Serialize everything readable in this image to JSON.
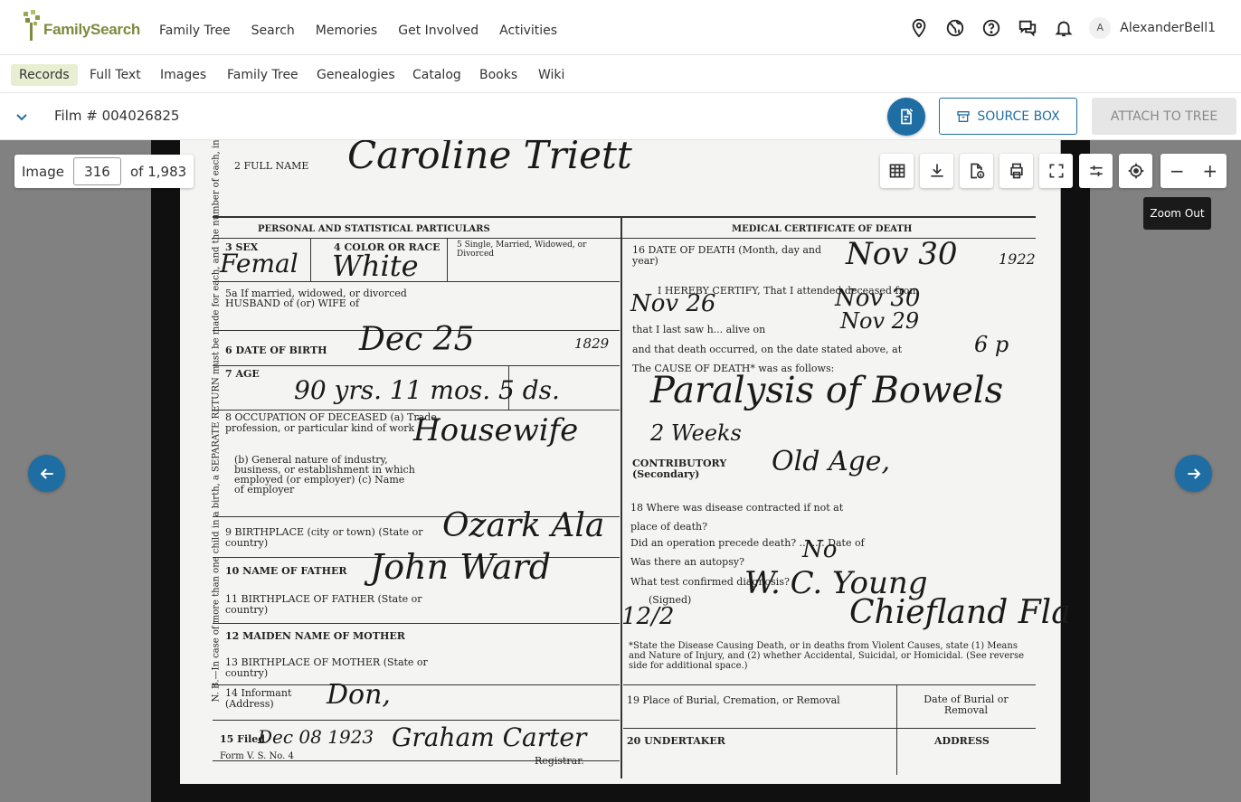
{
  "brand": {
    "logo_text": "FamilySearch"
  },
  "main_menu": [
    "Family Tree",
    "Search",
    "Memories",
    "Get Involved",
    "Activities"
  ],
  "user": {
    "initial": "A",
    "name": "AlexanderBell1"
  },
  "sub_menu": [
    "Records",
    "Full Text",
    "Images",
    "Family Tree",
    "Genealogies",
    "Catalog",
    "Books",
    "Wiki"
  ],
  "sub_menu_active": "Records",
  "film": {
    "title": "Film # 004026825"
  },
  "actions": {
    "source_box": "SOURCE BOX",
    "attach": "ATTACH TO TREE"
  },
  "image_nav": {
    "label": "Image",
    "current": "316",
    "total": "of 1,983"
  },
  "zoom": {
    "minus": "−",
    "plus": "+",
    "tooltip": "Zoom Out"
  },
  "certificate": {
    "full_name_label": "2 FULL NAME",
    "full_name": "Caroline Triett",
    "personal_header": "PERSONAL AND STATISTICAL PARTICULARS",
    "medical_header": "MEDICAL CERTIFICATE OF DEATH",
    "sex_label": "3 SEX",
    "sex": "Femal",
    "color_label": "4 COLOR OR RACE",
    "color": "White",
    "marital_label": "5 Single, Married, Widowed, or Divorced",
    "husband_label": "5a If married, widowed, or divorced HUSBAND of (or) WIFE of",
    "birth_label": "6 DATE OF BIRTH",
    "birth_date": "Dec 25",
    "birth_year": "1829",
    "age_label": "7 AGE",
    "age": "90  yrs. 11  mos. 5  ds.",
    "occupation_label": "8 OCCUPATION OF DECEASED (a) Trade, profession, or particular kind of work",
    "occupation": "Housewife",
    "occupation_b": "(b) General nature of industry, business, or establishment in which employed (or employer) (c) Name of employer",
    "birthplace_label": "9 BIRTHPLACE (city or town) (State or country)",
    "birthplace": "Ozark Ala",
    "father_label": "10 NAME OF FATHER",
    "father": "John Ward",
    "father_birthplace_label": "11 BIRTHPLACE OF FATHER (State or country)",
    "mother_label": "12 MAIDEN NAME OF MOTHER",
    "mother_birthplace_label": "13 BIRTHPLACE OF MOTHER (State or country)",
    "informant_label": "14 Informant (Address)",
    "informant": "Don,",
    "filed_label": "15 Filed",
    "filed": "Dec 08 1923",
    "registrar": "Graham Carter",
    "registrar_label": "Registrar.",
    "form_label": "Form V. S. No. 4",
    "death_date_label": "16 DATE OF DEATH (Month, day and year)",
    "death_date": "Nov 30",
    "death_year": "1922",
    "certify_line": "I HEREBY CERTIFY, That I attended deceased from",
    "certify_from": "Nov 26",
    "certify_to": "Nov 30",
    "last_saw_line": "that I last saw h... alive on",
    "last_saw": "Nov 29",
    "death_occurred": "and that death occurred, on the date stated above, at",
    "death_time": "6 p",
    "cause_label": "The CAUSE OF DEATH* was as follows:",
    "cause": "Paralysis of Bowels",
    "duration": "2 Weeks",
    "contributory_label": "CONTRIBUTORY (Secondary)",
    "contributory": "Old Age,",
    "disease_contracted": "18 Where was disease contracted if not at place of death?",
    "operation": "Did an operation precede death? ........ Date of",
    "autopsy": "Was there an autopsy?",
    "autopsy_answer": "No",
    "test": "What test confirmed diagnosis?",
    "signed_label": "(Signed)",
    "signed": "W. C. Young",
    "signed_date": "12/2",
    "address": "Chiefland Fla",
    "footnote": "*State the Disease Causing Death, or in deaths from Violent Causes, state (1) Means and Nature of Injury, and (2) whether Accidental, Suicidal, or Homicidal. (See reverse side for additional space.)",
    "burial_label": "19 Place of Burial, Cremation, or Removal",
    "burial_date_label": "Date of Burial or Removal",
    "undertaker_label": "20 UNDERTAKER",
    "undertaker_address": "ADDRESS",
    "margin_note": "N. B.—In case of more than one child in a birth, a SEPARATE RETURN must be made for each, and the number of each, in order of birth, stated."
  }
}
